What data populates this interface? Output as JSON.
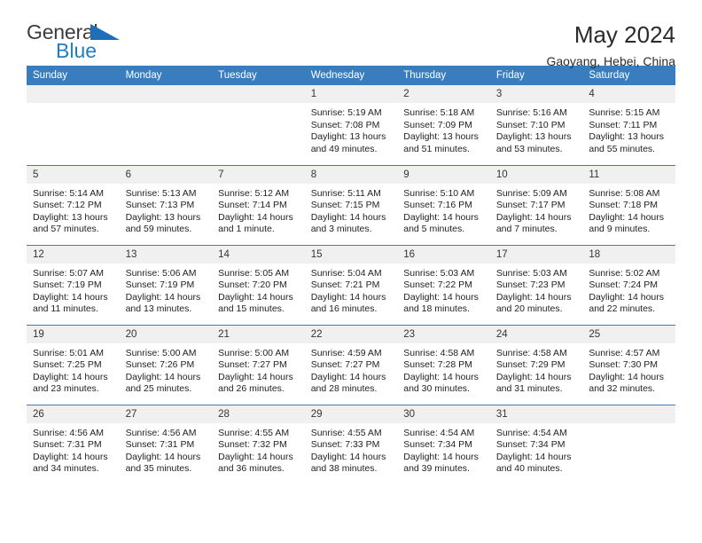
{
  "brand": {
    "name_top": "General",
    "name_bottom": "Blue",
    "triangle_color": "#1d70b8",
    "blue_color": "#1f7fc4"
  },
  "header": {
    "title": "May 2024",
    "location": "Gaoyang, Hebei, China"
  },
  "theme": {
    "header_bg": "#3a7dbf",
    "date_band_bg": "#f0f0f0",
    "separator": "#3a7dbf"
  },
  "weekdays": [
    "Sunday",
    "Monday",
    "Tuesday",
    "Wednesday",
    "Thursday",
    "Friday",
    "Saturday"
  ],
  "weeks": [
    [
      {
        "date": "",
        "blank": true
      },
      {
        "date": "",
        "blank": true
      },
      {
        "date": "",
        "blank": true
      },
      {
        "date": "1",
        "sunrise": "Sunrise: 5:19 AM",
        "sunset": "Sunset: 7:08 PM",
        "daylight1": "Daylight: 13 hours",
        "daylight2": "and 49 minutes."
      },
      {
        "date": "2",
        "sunrise": "Sunrise: 5:18 AM",
        "sunset": "Sunset: 7:09 PM",
        "daylight1": "Daylight: 13 hours",
        "daylight2": "and 51 minutes."
      },
      {
        "date": "3",
        "sunrise": "Sunrise: 5:16 AM",
        "sunset": "Sunset: 7:10 PM",
        "daylight1": "Daylight: 13 hours",
        "daylight2": "and 53 minutes."
      },
      {
        "date": "4",
        "sunrise": "Sunrise: 5:15 AM",
        "sunset": "Sunset: 7:11 PM",
        "daylight1": "Daylight: 13 hours",
        "daylight2": "and 55 minutes."
      }
    ],
    [
      {
        "date": "5",
        "sunrise": "Sunrise: 5:14 AM",
        "sunset": "Sunset: 7:12 PM",
        "daylight1": "Daylight: 13 hours",
        "daylight2": "and 57 minutes."
      },
      {
        "date": "6",
        "sunrise": "Sunrise: 5:13 AM",
        "sunset": "Sunset: 7:13 PM",
        "daylight1": "Daylight: 13 hours",
        "daylight2": "and 59 minutes."
      },
      {
        "date": "7",
        "sunrise": "Sunrise: 5:12 AM",
        "sunset": "Sunset: 7:14 PM",
        "daylight1": "Daylight: 14 hours",
        "daylight2": "and 1 minute."
      },
      {
        "date": "8",
        "sunrise": "Sunrise: 5:11 AM",
        "sunset": "Sunset: 7:15 PM",
        "daylight1": "Daylight: 14 hours",
        "daylight2": "and 3 minutes."
      },
      {
        "date": "9",
        "sunrise": "Sunrise: 5:10 AM",
        "sunset": "Sunset: 7:16 PM",
        "daylight1": "Daylight: 14 hours",
        "daylight2": "and 5 minutes."
      },
      {
        "date": "10",
        "sunrise": "Sunrise: 5:09 AM",
        "sunset": "Sunset: 7:17 PM",
        "daylight1": "Daylight: 14 hours",
        "daylight2": "and 7 minutes."
      },
      {
        "date": "11",
        "sunrise": "Sunrise: 5:08 AM",
        "sunset": "Sunset: 7:18 PM",
        "daylight1": "Daylight: 14 hours",
        "daylight2": "and 9 minutes."
      }
    ],
    [
      {
        "date": "12",
        "sunrise": "Sunrise: 5:07 AM",
        "sunset": "Sunset: 7:19 PM",
        "daylight1": "Daylight: 14 hours",
        "daylight2": "and 11 minutes."
      },
      {
        "date": "13",
        "sunrise": "Sunrise: 5:06 AM",
        "sunset": "Sunset: 7:19 PM",
        "daylight1": "Daylight: 14 hours",
        "daylight2": "and 13 minutes."
      },
      {
        "date": "14",
        "sunrise": "Sunrise: 5:05 AM",
        "sunset": "Sunset: 7:20 PM",
        "daylight1": "Daylight: 14 hours",
        "daylight2": "and 15 minutes."
      },
      {
        "date": "15",
        "sunrise": "Sunrise: 5:04 AM",
        "sunset": "Sunset: 7:21 PM",
        "daylight1": "Daylight: 14 hours",
        "daylight2": "and 16 minutes."
      },
      {
        "date": "16",
        "sunrise": "Sunrise: 5:03 AM",
        "sunset": "Sunset: 7:22 PM",
        "daylight1": "Daylight: 14 hours",
        "daylight2": "and 18 minutes."
      },
      {
        "date": "17",
        "sunrise": "Sunrise: 5:03 AM",
        "sunset": "Sunset: 7:23 PM",
        "daylight1": "Daylight: 14 hours",
        "daylight2": "and 20 minutes."
      },
      {
        "date": "18",
        "sunrise": "Sunrise: 5:02 AM",
        "sunset": "Sunset: 7:24 PM",
        "daylight1": "Daylight: 14 hours",
        "daylight2": "and 22 minutes."
      }
    ],
    [
      {
        "date": "19",
        "sunrise": "Sunrise: 5:01 AM",
        "sunset": "Sunset: 7:25 PM",
        "daylight1": "Daylight: 14 hours",
        "daylight2": "and 23 minutes."
      },
      {
        "date": "20",
        "sunrise": "Sunrise: 5:00 AM",
        "sunset": "Sunset: 7:26 PM",
        "daylight1": "Daylight: 14 hours",
        "daylight2": "and 25 minutes."
      },
      {
        "date": "21",
        "sunrise": "Sunrise: 5:00 AM",
        "sunset": "Sunset: 7:27 PM",
        "daylight1": "Daylight: 14 hours",
        "daylight2": "and 26 minutes."
      },
      {
        "date": "22",
        "sunrise": "Sunrise: 4:59 AM",
        "sunset": "Sunset: 7:27 PM",
        "daylight1": "Daylight: 14 hours",
        "daylight2": "and 28 minutes."
      },
      {
        "date": "23",
        "sunrise": "Sunrise: 4:58 AM",
        "sunset": "Sunset: 7:28 PM",
        "daylight1": "Daylight: 14 hours",
        "daylight2": "and 30 minutes."
      },
      {
        "date": "24",
        "sunrise": "Sunrise: 4:58 AM",
        "sunset": "Sunset: 7:29 PM",
        "daylight1": "Daylight: 14 hours",
        "daylight2": "and 31 minutes."
      },
      {
        "date": "25",
        "sunrise": "Sunrise: 4:57 AM",
        "sunset": "Sunset: 7:30 PM",
        "daylight1": "Daylight: 14 hours",
        "daylight2": "and 32 minutes."
      }
    ],
    [
      {
        "date": "26",
        "sunrise": "Sunrise: 4:56 AM",
        "sunset": "Sunset: 7:31 PM",
        "daylight1": "Daylight: 14 hours",
        "daylight2": "and 34 minutes."
      },
      {
        "date": "27",
        "sunrise": "Sunrise: 4:56 AM",
        "sunset": "Sunset: 7:31 PM",
        "daylight1": "Daylight: 14 hours",
        "daylight2": "and 35 minutes."
      },
      {
        "date": "28",
        "sunrise": "Sunrise: 4:55 AM",
        "sunset": "Sunset: 7:32 PM",
        "daylight1": "Daylight: 14 hours",
        "daylight2": "and 36 minutes."
      },
      {
        "date": "29",
        "sunrise": "Sunrise: 4:55 AM",
        "sunset": "Sunset: 7:33 PM",
        "daylight1": "Daylight: 14 hours",
        "daylight2": "and 38 minutes."
      },
      {
        "date": "30",
        "sunrise": "Sunrise: 4:54 AM",
        "sunset": "Sunset: 7:34 PM",
        "daylight1": "Daylight: 14 hours",
        "daylight2": "and 39 minutes."
      },
      {
        "date": "31",
        "sunrise": "Sunrise: 4:54 AM",
        "sunset": "Sunset: 7:34 PM",
        "daylight1": "Daylight: 14 hours",
        "daylight2": "and 40 minutes."
      },
      {
        "date": "",
        "blank": true
      }
    ]
  ]
}
